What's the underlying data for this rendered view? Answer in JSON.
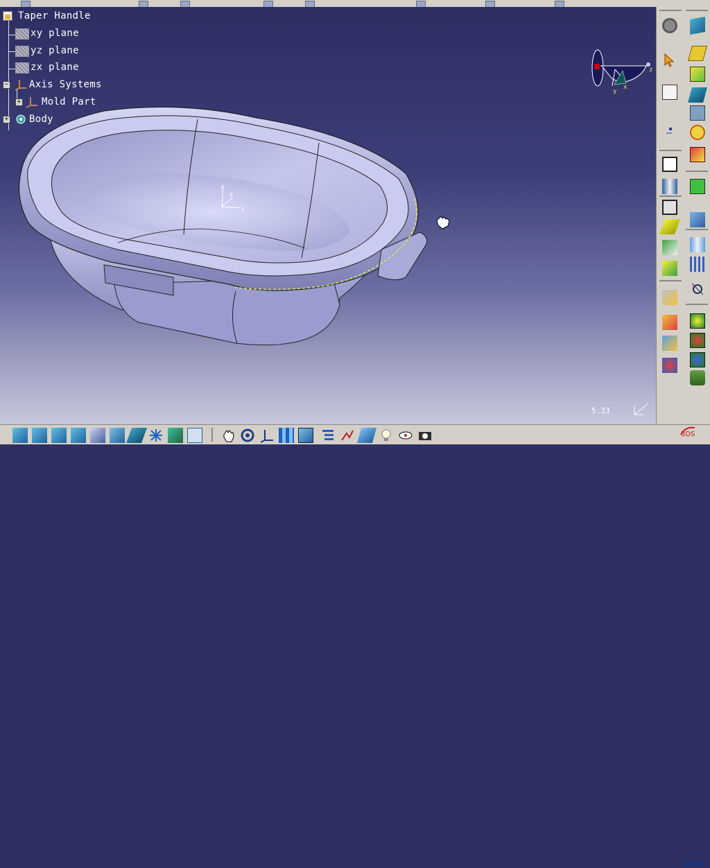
{
  "tree": {
    "root": "Taper Handle",
    "items": [
      {
        "label": "xy plane"
      },
      {
        "label": "yz plane"
      },
      {
        "label": "zx plane"
      },
      {
        "label": "Axis Systems"
      },
      {
        "label": "Mold Part"
      },
      {
        "label": "Body"
      }
    ]
  },
  "compass": {
    "x_label": "x",
    "y_label": "y",
    "z_label": "z"
  },
  "part_axis": {
    "x_label": "x",
    "y_label": "y",
    "z_label": "z"
  },
  "zoom": "5.33",
  "brand": {
    "logo_text": "CATIA",
    "logo_color": "#0a3a9a"
  },
  "colors": {
    "background_top": "#2d2e62",
    "background_bottom": "#c8c8dc",
    "model": "#b9bbe6",
    "highlight": "#e8e84a"
  }
}
